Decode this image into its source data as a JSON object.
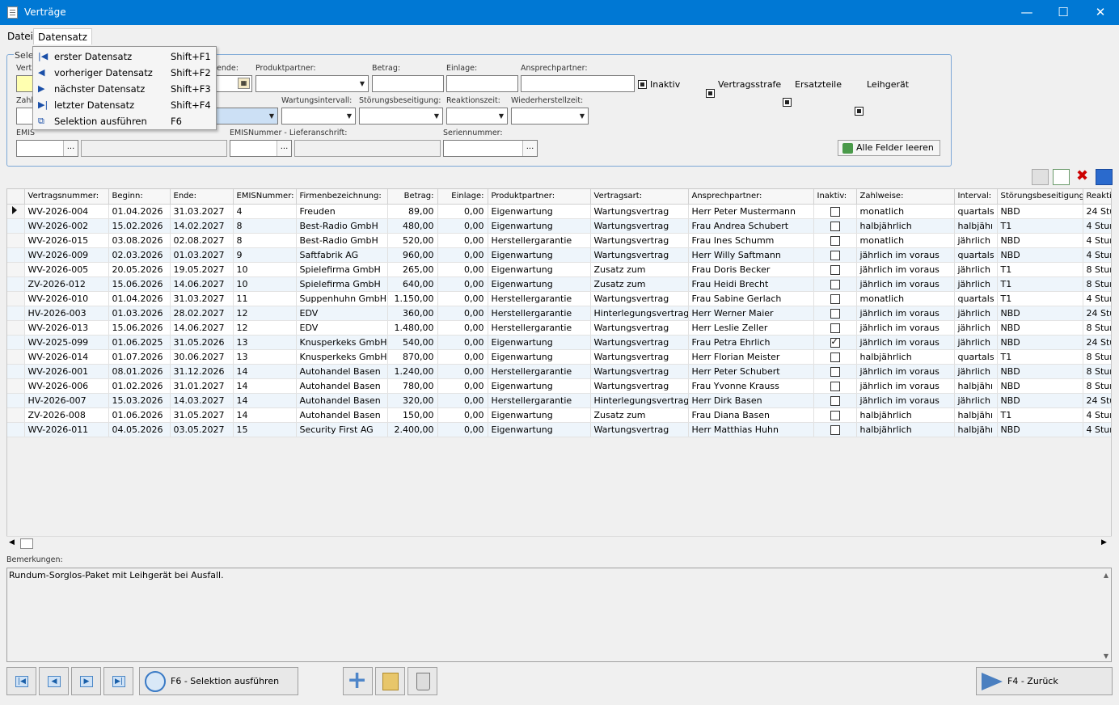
{
  "window": {
    "title": "Verträge",
    "min": "—",
    "max": "☐",
    "close": "✕"
  },
  "menubar": {
    "items": [
      "Datei",
      "Datensatz"
    ]
  },
  "dropdown_menu": [
    {
      "label": "erster Datensatz",
      "shortcut": "Shift+F1",
      "icon": "first-record-icon"
    },
    {
      "label": "vorheriger Datensatz",
      "shortcut": "Shift+F2",
      "icon": "prev-record-icon"
    },
    {
      "label": "nächster Datensatz",
      "shortcut": "Shift+F3",
      "icon": "next-record-icon"
    },
    {
      "label": "letzter Datensatz",
      "shortcut": "Shift+F4",
      "icon": "last-record-icon"
    },
    {
      "label": "Selektion ausführen",
      "shortcut": "F6",
      "icon": "selection-icon"
    }
  ],
  "selection": {
    "group_title": "Sele",
    "labels": {
      "vert": "Vert",
      "ende": "ende:",
      "produktpartner": "Produktpartner:",
      "betrag": "Betrag:",
      "einlage": "Einlage:",
      "ansprechpartner": "Ansprechpartner:",
      "zahl": "Zahl",
      "wartungsintervall": "Wartungsintervall:",
      "stoerungsbeseitigung": "Störungsbeseitigung:",
      "reaktionszeit": "Reaktionszeit:",
      "wiederherstellzeit": "Wiederherstellzeit:",
      "emis": "EMIS",
      "emis_liefer": "EMISNummer - Lieferanschrift:",
      "seriennummer": "Seriennummer:"
    },
    "checkboxes": {
      "inaktiv": "Inaktiv",
      "vertragsstrafe": "Vertragsstrafe",
      "ersatzteile": "Ersatzteile",
      "leihgeraet": "Leihgerät"
    },
    "clear_button": "Alle Felder leeren",
    "dots": "..."
  },
  "grid": {
    "columns": [
      "Vertragsnummer:",
      "Beginn:",
      "Ende:",
      "EMISNummer:",
      "Firmenbezeichnung:",
      "Betrag:",
      "Einlage:",
      "Produktpartner:",
      "Vertragsart:",
      "Ansprechpartner:",
      "Inaktiv:",
      "Zahlweise:",
      "Interval:",
      "Störungsbeseitigung:",
      "Reaktic"
    ],
    "rows": [
      [
        "WV-2026-004",
        "01.04.2026",
        "31.03.2027",
        "4",
        "Freuden",
        "89,00",
        "0,00",
        "Eigenwartung",
        "Wartungsvertrag",
        "Herr Peter Mustermann",
        false,
        "monatlich",
        "quartals",
        "NBD",
        "24 Stun"
      ],
      [
        "WV-2026-002",
        "15.02.2026",
        "14.02.2027",
        "8",
        "Best-Radio GmbH",
        "480,00",
        "0,00",
        "Eigenwartung",
        "Wartungsvertrag",
        "Frau Andrea Schubert",
        false,
        "halbjährlich",
        "halbjähı",
        "T1",
        "4 Stun"
      ],
      [
        "WV-2026-015",
        "03.08.2026",
        "02.08.2027",
        "8",
        "Best-Radio GmbH",
        "520,00",
        "0,00",
        "Herstellergarantie",
        "Wartungsvertrag",
        "Frau Ines Schumm",
        false,
        "monatlich",
        "jährlich",
        "NBD",
        "4 Stun"
      ],
      [
        "WV-2026-009",
        "02.03.2026",
        "01.03.2027",
        "9",
        "Saftfabrik AG",
        "960,00",
        "0,00",
        "Eigenwartung",
        "Wartungsvertrag",
        "Herr Willy Saftmann",
        false,
        "jährlich im voraus",
        "quartals",
        "NBD",
        "4 Stun"
      ],
      [
        "WV-2026-005",
        "20.05.2026",
        "19.05.2027",
        "10",
        "Spielefirma GmbH",
        "265,00",
        "0,00",
        "Eigenwartung",
        "Zusatz zum",
        "Frau Doris Becker",
        false,
        "jährlich im voraus",
        "jährlich",
        "T1",
        "8 Stun"
      ],
      [
        "ZV-2026-012",
        "15.06.2026",
        "14.06.2027",
        "10",
        "Spielefirma GmbH",
        "640,00",
        "0,00",
        "Eigenwartung",
        "Zusatz zum",
        "Frau Heidi Brecht",
        false,
        "jährlich im voraus",
        "jährlich",
        "T1",
        "8 Stun"
      ],
      [
        "WV-2026-010",
        "01.04.2026",
        "31.03.2027",
        "11",
        "Suppenhuhn GmbH",
        "1.150,00",
        "0,00",
        "Herstellergarantie",
        "Wartungsvertrag",
        "Frau Sabine Gerlach",
        false,
        "monatlich",
        "quartals",
        "T1",
        "4 Stun"
      ],
      [
        "HV-2026-003",
        "01.03.2026",
        "28.02.2027",
        "12",
        "EDV",
        "360,00",
        "0,00",
        "Herstellergarantie",
        "Hinterlegungsvertrag",
        "Herr Werner Maier",
        false,
        "jährlich im voraus",
        "jährlich",
        "NBD",
        "24 Stu"
      ],
      [
        "WV-2026-013",
        "15.06.2026",
        "14.06.2027",
        "12",
        "EDV",
        "1.480,00",
        "0,00",
        "Herstellergarantie",
        "Wartungsvertrag",
        "Herr Leslie Zeller",
        false,
        "jährlich im voraus",
        "jährlich",
        "NBD",
        "8 Stun"
      ],
      [
        "WV-2025-099",
        "01.06.2025",
        "31.05.2026",
        "13",
        "Knusperkeks GmbH",
        "540,00",
        "0,00",
        "Eigenwartung",
        "Wartungsvertrag",
        "Frau Petra Ehrlich",
        true,
        "jährlich im voraus",
        "jährlich",
        "NBD",
        "24 Stu"
      ],
      [
        "WV-2026-014",
        "01.07.2026",
        "30.06.2027",
        "13",
        "Knusperkeks GmbH",
        "870,00",
        "0,00",
        "Eigenwartung",
        "Wartungsvertrag",
        "Herr Florian Meister",
        false,
        "halbjährlich",
        "quartals",
        "T1",
        "8 Stun"
      ],
      [
        "WV-2026-001",
        "08.01.2026",
        "31.12.2026",
        "14",
        "Autohandel Basen",
        "1.240,00",
        "0,00",
        "Herstellergarantie",
        "Wartungsvertrag",
        "Herr Peter Schubert",
        false,
        "jährlich im voraus",
        "jährlich",
        "NBD",
        "8 Stun"
      ],
      [
        "WV-2026-006",
        "01.02.2026",
        "31.01.2027",
        "14",
        "Autohandel Basen",
        "780,00",
        "0,00",
        "Eigenwartung",
        "Wartungsvertrag",
        "Frau Yvonne Krauss",
        false,
        "jährlich im voraus",
        "halbjähı",
        "NBD",
        "8 Stun"
      ],
      [
        "HV-2026-007",
        "15.03.2026",
        "14.03.2027",
        "14",
        "Autohandel Basen",
        "320,00",
        "0,00",
        "Herstellergarantie",
        "Hinterlegungsvertrag",
        "Herr Dirk Basen",
        false,
        "jährlich im voraus",
        "jährlich",
        "NBD",
        "24 Stu"
      ],
      [
        "ZV-2026-008",
        "01.06.2026",
        "31.05.2027",
        "14",
        "Autohandel Basen",
        "150,00",
        "0,00",
        "Eigenwartung",
        "Zusatz zum",
        "Frau Diana Basen",
        false,
        "halbjährlich",
        "halbjähı",
        "T1",
        "4 Stun"
      ],
      [
        "WV-2026-011",
        "04.05.2026",
        "03.05.2027",
        "15",
        "Security First AG",
        "2.400,00",
        "0,00",
        "Eigenwartung",
        "Wartungsvertrag",
        "Herr Matthias Huhn",
        false,
        "halbjährlich",
        "halbjähı",
        "NBD",
        "4 Stun"
      ]
    ]
  },
  "notes": {
    "label": "Bemerkungen:",
    "text": "Rundum-Sorglos-Paket mit Leihgerät bei Ausfall."
  },
  "bottom": {
    "selection_button": "F6 - Selektion ausführen",
    "back_button": "F4 - Zurück"
  }
}
